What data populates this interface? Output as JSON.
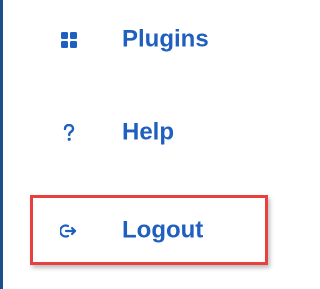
{
  "sidebar": {
    "items": [
      {
        "label": "Plugins",
        "icon": "grid-icon"
      },
      {
        "label": "Help",
        "icon": "question-icon"
      },
      {
        "label": "Logout",
        "icon": "logout-icon"
      }
    ]
  },
  "colors": {
    "accent": "#1f5fbf",
    "border": "#1d4f8f",
    "highlight": "#e8403f"
  }
}
